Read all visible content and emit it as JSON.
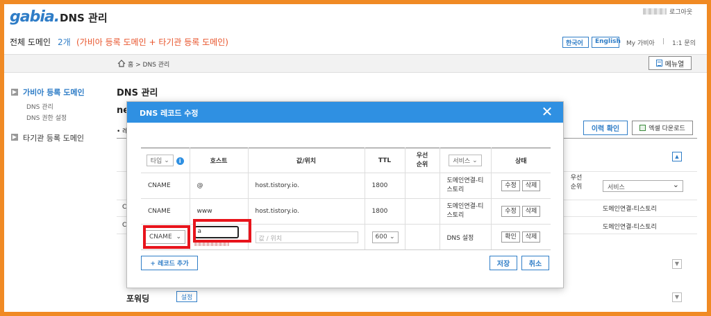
{
  "header": {
    "logo": "gabia.",
    "app_title": "DNS 관리",
    "logout": "로그아웃",
    "domain_label": "전체 도메인",
    "domain_count": "2개",
    "domain_desc": "(가비아 등록 도메인 + 타기관 등록 도메인)",
    "lang_ko": "한국어",
    "lang_en": "English",
    "my_gabia": "My 가비아",
    "separator": "|",
    "one_to_one": "1:1 문의"
  },
  "breadcrumb": {
    "text": "홈 > DNS 관리",
    "menu_button": "메뉴열"
  },
  "sidebar": {
    "section1": "가비아 등록 도메인",
    "sub1": "DNS 관리",
    "sub2": "DNS 권한 설정",
    "section2": "타기관 등록 도메인"
  },
  "main": {
    "title": "DNS 관리",
    "domain_partial": "ne",
    "bullet": "• 레",
    "history_button": "이력 확인",
    "excel_button": "엑셀 다운로드",
    "priority_label": "우선 순위",
    "service_select": "서비스",
    "row1_status": "도메인연결-티스토리",
    "row2_status": "도메인연결-티스토리",
    "row1_type": "C",
    "row2_type": "C",
    "forwarding_label": "포워딩",
    "forwarding_button": "설정"
  },
  "modal": {
    "title": "DNS 레코드 수정",
    "columns": {
      "type_select": "타입",
      "host": "호스트",
      "value": "값/위치",
      "ttl": "TTL",
      "priority": "우선 순위",
      "service_select": "서비스",
      "status": "상태"
    },
    "rows": [
      {
        "type": "CNAME",
        "host": "@",
        "value": "host.tistory.io.",
        "ttl": "1800",
        "priority": "",
        "service": "도메인연결-티스토리",
        "edit": "수정",
        "delete": "삭제"
      },
      {
        "type": "CNAME",
        "host": "www",
        "value": "host.tistory.io.",
        "ttl": "1800",
        "priority": "",
        "service": "도메인연결-티스토리",
        "edit": "수정",
        "delete": "삭제"
      }
    ],
    "new_row": {
      "type": "CNAME",
      "host_value": "a",
      "value_placeholder": "값 / 위치",
      "ttl": "600",
      "service": "DNS 설정",
      "confirm": "확인",
      "delete": "삭제"
    },
    "add_record": "+ 레코드 추가",
    "save": "저장",
    "cancel": "취소"
  },
  "colors": {
    "accent": "#2f7dc7",
    "modal_header": "#2f90e2",
    "highlight": "#e8141c",
    "frame": "#f08a24",
    "domain_desc": "#e8542b"
  }
}
